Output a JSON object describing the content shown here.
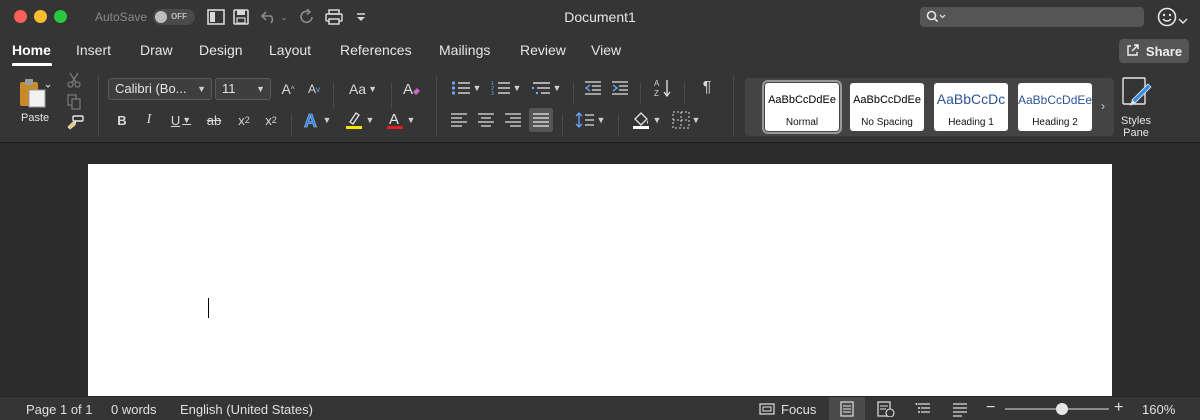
{
  "window": {
    "title": "Document1",
    "autosave_label": "AutoSave",
    "autosave_state": "OFF"
  },
  "quick_access": [
    "sidebar-icon",
    "save-icon",
    "undo-icon",
    "redo-icon",
    "print-icon",
    "customize-icon"
  ],
  "search": {
    "placeholder": ""
  },
  "ribbon_tabs": [
    {
      "label": "Home",
      "active": true
    },
    {
      "label": "Insert"
    },
    {
      "label": "Draw"
    },
    {
      "label": "Design"
    },
    {
      "label": "Layout"
    },
    {
      "label": "References"
    },
    {
      "label": "Mailings"
    },
    {
      "label": "Review"
    },
    {
      "label": "View"
    }
  ],
  "share_button": "Share",
  "clipboard": {
    "paste_label": "Paste"
  },
  "font": {
    "family": "Calibri (Bo...",
    "size": "11",
    "grow": "A",
    "shrink": "A",
    "change_case": "Aa",
    "bold": "B",
    "italic": "I",
    "underline": "U",
    "strikethrough": "ab",
    "subscript": "x",
    "superscript": "x",
    "subscript_mark": "2",
    "superscript_mark": "2",
    "text_effects": "A",
    "highlight": "",
    "font_color": "A"
  },
  "paragraph": {
    "show_marks": "¶"
  },
  "styles": [
    {
      "sample": "AaBbCcDdEe",
      "name": "Normal",
      "selected": true
    },
    {
      "sample": "AaBbCcDdEe",
      "name": "No Spacing"
    },
    {
      "sample": "AaBbCcDc",
      "name": "Heading 1"
    },
    {
      "sample": "AaBbCcDdEe",
      "name": "Heading 2"
    }
  ],
  "styles_pane": {
    "line1": "Styles",
    "line2": "Pane"
  },
  "status": {
    "page": "Page 1 of 1",
    "words": "0 words",
    "language": "English (United States)",
    "focus": "Focus",
    "zoom_minus": "−",
    "zoom_plus": "+",
    "zoom": "160%",
    "zoom_level_fraction": 0.55
  },
  "colors": {
    "chrome": "#353535",
    "canvas": "#2b2b2b",
    "page": "#ffffff",
    "highlight_yellow": "#f5e50a",
    "font_red": "#e02020",
    "text_effects_blue": "#3a8ee6"
  }
}
